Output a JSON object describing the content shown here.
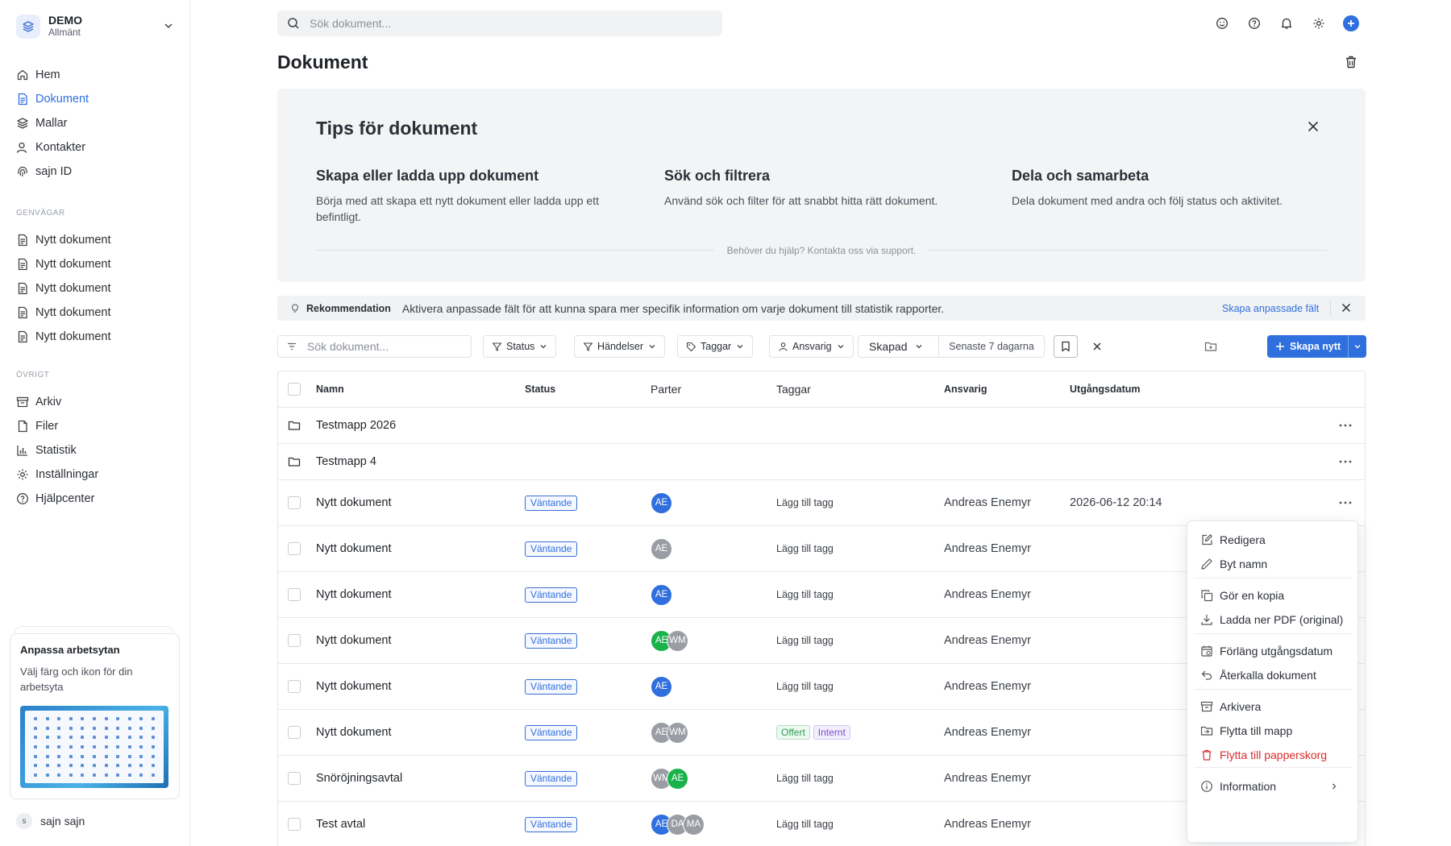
{
  "workspace": {
    "name": "DEMO",
    "sub": "Allmänt"
  },
  "nav": [
    {
      "label": "Hem",
      "icon": "home-icon"
    },
    {
      "label": "Dokument",
      "icon": "document-icon"
    },
    {
      "label": "Mallar",
      "icon": "layers-icon"
    },
    {
      "label": "Kontakter",
      "icon": "contacts-icon"
    },
    {
      "label": "sajn ID",
      "icon": "fingerprint-icon"
    }
  ],
  "shortcuts": {
    "heading": "GENVÄGAR",
    "items": [
      "Nytt dokument",
      "Nytt dokument",
      "Nytt dokument",
      "Nytt dokument",
      "Nytt dokument"
    ]
  },
  "other": {
    "heading": "ÖVRIGT",
    "items": [
      {
        "label": "Arkiv",
        "icon": "archive-icon"
      },
      {
        "label": "Filer",
        "icon": "file-icon"
      },
      {
        "label": "Statistik",
        "icon": "chart-icon"
      },
      {
        "label": "Inställningar",
        "icon": "gear-icon"
      },
      {
        "label": "Hjälpcenter",
        "icon": "help-icon"
      }
    ]
  },
  "promo": {
    "title": "Anpassa arbetsytan",
    "text": "Välj färg och ikon för din arbetsyta"
  },
  "user": {
    "initial": "s",
    "name": "sajn sajn"
  },
  "search": {
    "placeholder": "Sök dokument..."
  },
  "page": {
    "title": "Dokument"
  },
  "tips": {
    "title": "Tips för dokument",
    "cols": [
      {
        "h": "Skapa eller ladda upp dokument",
        "p": "Börja med att skapa ett nytt dokument eller ladda upp ett befintligt."
      },
      {
        "h": "Sök och filtrera",
        "p": "Använd sök och filter för att snabbt hitta rätt dokument."
      },
      {
        "h": "Dela och samarbeta",
        "p": "Dela dokument med andra och följ status och aktivitet."
      }
    ],
    "help": "Behöver du hjälp? Kontakta oss via support."
  },
  "recommendation": {
    "label": "Rekommendation",
    "text": "Aktivera anpassade fält för att kunna spara mer specifik information om varje dokument till statistik rapporter.",
    "link": "Skapa anpassade fält"
  },
  "filters": {
    "search_placeholder": "Sök dokument...",
    "status": "Status",
    "events": "Händelser",
    "tags": "Taggar",
    "responsible": "Ansvarig",
    "created": "Skapad",
    "range": "Senaste 7 dagarna",
    "create": "Skapa nytt"
  },
  "table": {
    "headers": {
      "name": "Namn",
      "status": "Status",
      "parties": "Parter",
      "tags": "Taggar",
      "responsible": "Ansvarig",
      "expiry": "Utgångsdatum"
    },
    "folders": [
      "Testmapp 2026",
      "Testmapp 4"
    ],
    "rows": [
      {
        "name": "Nytt dokument",
        "status": "Väntande",
        "parties": [
          {
            "i": "AE",
            "c": "#2f6fde"
          }
        ],
        "tag_action": "Lägg till tagg",
        "responsible": "Andreas Enemyr",
        "expiry": "2026-06-12 20:14"
      },
      {
        "name": "Nytt dokument",
        "status": "Väntande",
        "parties": [
          {
            "i": "AE",
            "c": "#9a9da3"
          }
        ],
        "tag_action": "Lägg till tagg",
        "responsible": "Andreas Enemyr",
        "expiry": ""
      },
      {
        "name": "Nytt dokument",
        "status": "Väntande",
        "parties": [
          {
            "i": "AE",
            "c": "#2f6fde"
          }
        ],
        "tag_action": "Lägg till tagg",
        "responsible": "Andreas Enemyr",
        "expiry": ""
      },
      {
        "name": "Nytt dokument",
        "status": "Väntande",
        "parties": [
          {
            "i": "AE",
            "c": "#19b24b"
          },
          {
            "i": "WM",
            "c": "#9a9da3"
          }
        ],
        "tag_action": "Lägg till tagg",
        "responsible": "Andreas Enemyr",
        "expiry": ""
      },
      {
        "name": "Nytt dokument",
        "status": "Väntande",
        "parties": [
          {
            "i": "AE",
            "c": "#2f6fde"
          }
        ],
        "tag_action": "Lägg till tagg",
        "responsible": "Andreas Enemyr",
        "expiry": ""
      },
      {
        "name": "Nytt dokument",
        "status": "Väntande",
        "parties": [
          {
            "i": "AE",
            "c": "#9a9da3"
          },
          {
            "i": "WM",
            "c": "#9a9da3"
          }
        ],
        "tags": [
          {
            "t": "Offert",
            "c": "#2e9e4f",
            "bg": "#edf8f0",
            "b": "#b8e2c4"
          },
          {
            "t": "Internt",
            "c": "#7b4fc9",
            "bg": "#f3eefc",
            "b": "#d6c6f2"
          }
        ],
        "responsible": "Andreas Enemyr",
        "expiry": ""
      },
      {
        "name": "Snöröjningsavtal",
        "status": "Väntande",
        "parties": [
          {
            "i": "WM",
            "c": "#9a9da3"
          },
          {
            "i": "AE",
            "c": "#19b24b"
          }
        ],
        "tag_action": "Lägg till tagg",
        "responsible": "Andreas Enemyr",
        "expiry": ""
      },
      {
        "name": "Test avtal",
        "status": "Väntande",
        "parties": [
          {
            "i": "AE",
            "c": "#2f6fde"
          },
          {
            "i": "DA",
            "c": "#9a9da3"
          },
          {
            "i": "MA",
            "c": "#9a9da3"
          }
        ],
        "tag_action": "Lägg till tagg",
        "responsible": "Andreas Enemyr",
        "expiry": ""
      }
    ]
  },
  "context_menu": {
    "items": [
      {
        "label": "Redigera",
        "icon": "edit-icon"
      },
      {
        "label": "Byt namn",
        "icon": "pencil-icon"
      },
      {
        "label": "Gör en kopia",
        "icon": "copy-icon"
      },
      {
        "label": "Ladda ner PDF (original)",
        "icon": "download-icon"
      },
      {
        "label": "Förläng utgångsdatum",
        "icon": "calendar-icon"
      },
      {
        "label": "Återkalla dokument",
        "icon": "undo-icon"
      },
      {
        "label": "Arkivera",
        "icon": "archive-icon"
      },
      {
        "label": "Flytta till mapp",
        "icon": "folder-move-icon"
      },
      {
        "label": "Flytta till papperskorg",
        "icon": "trash-icon"
      },
      {
        "label": "Information",
        "icon": "info-icon"
      }
    ]
  },
  "colors": {
    "accent": "#2f6fde",
    "danger": "#d92d2d"
  }
}
